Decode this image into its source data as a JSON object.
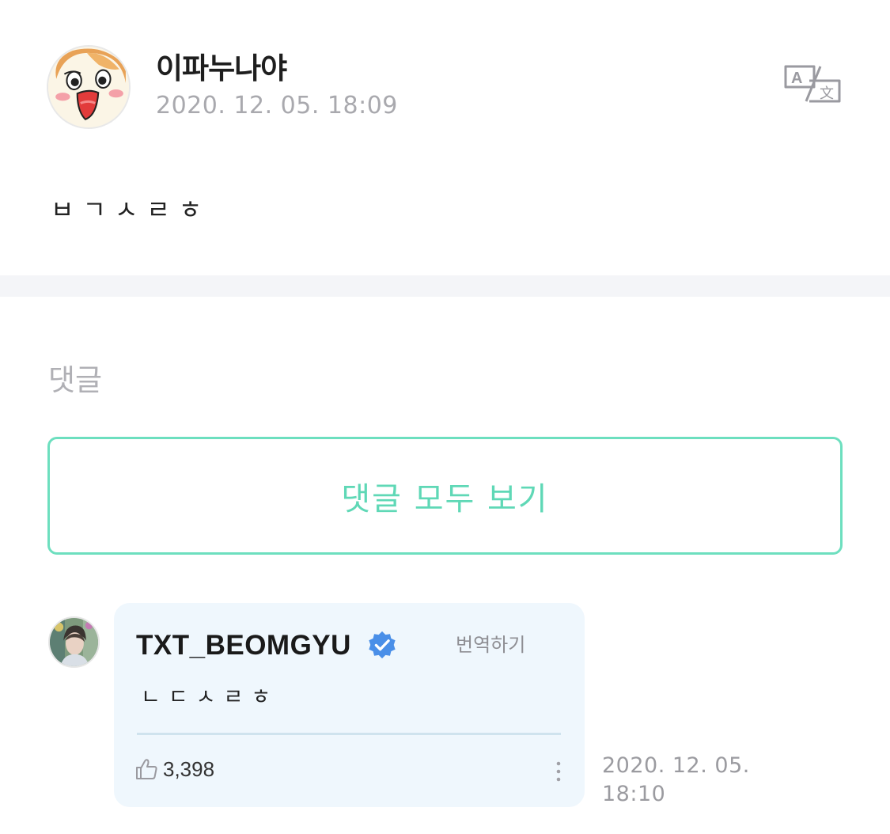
{
  "post": {
    "author_name": "이파누나야",
    "timestamp": "2020. 12. 05. 18:09",
    "body": "ㅂㄱㅅㄹㅎ",
    "translate_icon": "translate-icon"
  },
  "comments": {
    "heading": "댓글",
    "view_all_label": "댓글 모두 보기",
    "items": [
      {
        "author": "TXT_BEOMGYU",
        "verified": true,
        "translate_label": "번역하기",
        "text": "ㄴㄷㅅㄹㅎ",
        "likes": "3,398",
        "timestamp_line1": "2020. 12. 05.",
        "timestamp_line2": "18:10"
      }
    ]
  },
  "colors": {
    "accent": "#5fd8b6",
    "accent_border": "#6ddfbf",
    "bubble_bg": "#eff7fd",
    "verified_blue": "#4a8fe8",
    "muted_text": "#a9a9ae"
  }
}
